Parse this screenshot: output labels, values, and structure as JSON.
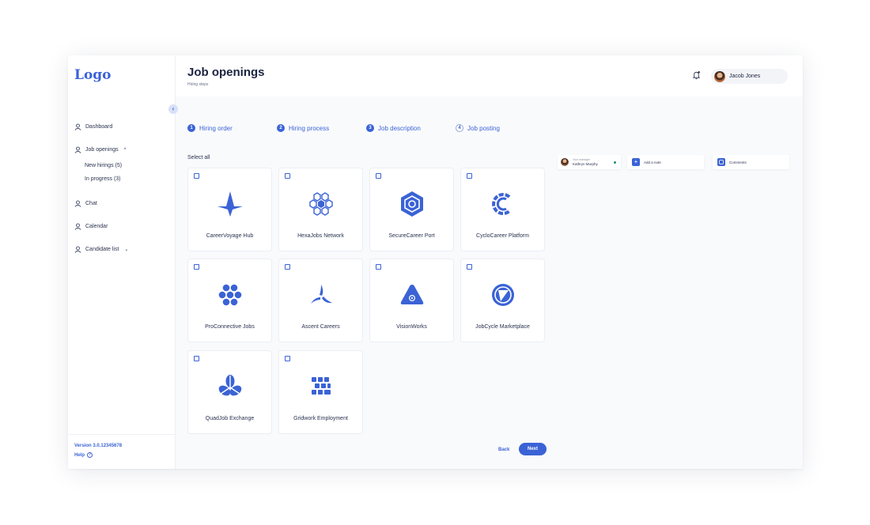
{
  "sidebar": {
    "logo": "Logo",
    "collapse_glyph": "‹",
    "items": [
      {
        "label": "Dashboard"
      },
      {
        "label": "Job openings",
        "caret": "^",
        "children": [
          "New hirings (5)",
          "In progress (3)"
        ]
      },
      {
        "label": "Chat"
      },
      {
        "label": "Calendar"
      },
      {
        "label": "Candidate list",
        "caret": "⌄"
      }
    ],
    "version": "Version 3.0.12345678",
    "help": "Help",
    "help_glyph": "?"
  },
  "header": {
    "title": "Job openings",
    "subtitle": "Hiring steps",
    "user_name": "Jacob Jones"
  },
  "stepper": [
    {
      "number": "1",
      "label": "Hiring order",
      "state": "done"
    },
    {
      "number": "2",
      "label": "Hiring process",
      "state": "done"
    },
    {
      "number": "3",
      "label": "Job description",
      "state": "done"
    },
    {
      "number": "4",
      "label": "Job posting",
      "state": "current"
    }
  ],
  "select_all": "Select all",
  "cards": [
    {
      "label": "CareerVoyage Hub",
      "icon": "star-compass-icon"
    },
    {
      "label": "HexaJobs Network",
      "icon": "hexagon-cluster-icon"
    },
    {
      "label": "SecureCareer Port",
      "icon": "hexagon-shield-icon"
    },
    {
      "label": "CycloCareer Platform",
      "icon": "cyclo-c-icon"
    },
    {
      "label": "ProConnective Jobs",
      "icon": "hex-flower-icon"
    },
    {
      "label": "Ascent Careers",
      "icon": "triskelion-icon"
    },
    {
      "label": "VisionWorks",
      "icon": "triangle-eye-icon"
    },
    {
      "label": "JobCycle Marketplace",
      "icon": "aperture-circle-icon"
    },
    {
      "label": "QuadJob Exchange",
      "icon": "trefoil-icon"
    },
    {
      "label": "Gridwork Employment",
      "icon": "block-grid-icon"
    }
  ],
  "panel": {
    "manager_caption": "Your manager",
    "manager_name": "Kathryn Murphy",
    "add_note": "Add a note",
    "add_glyph": "+",
    "comments": "Comments"
  },
  "footer": {
    "back": "Back",
    "next": "Next"
  },
  "colors": {
    "accent": "#3b63d6",
    "online": "#1e8e7a"
  }
}
